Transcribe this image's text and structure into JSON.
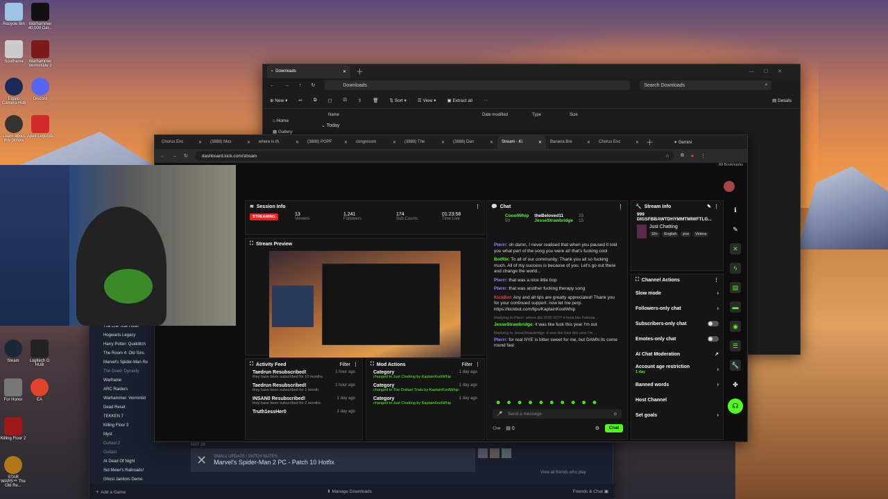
{
  "desktop": {
    "icons_left": [
      {
        "label": "Recycle Bin"
      },
      {
        "label": "Soulframe"
      },
      {
        "label": "Elgato Camera Hub"
      },
      {
        "label": "Learn about this picture"
      }
    ],
    "icons_right": [
      {
        "label": "Warhammer 40,000 Dar..."
      },
      {
        "label": "Warhammer Vermintide 2"
      },
      {
        "label": "Discord"
      },
      {
        "label": "Apex Legends"
      }
    ],
    "icons_bottom": [
      {
        "label": "Steam"
      },
      {
        "label": "Logitech G HUB"
      },
      {
        "label": "For Honor"
      },
      {
        "label": "EA"
      },
      {
        "label": "Killing Floor 2"
      },
      {
        "label": "STAR WARS™ The Old Re..."
      }
    ]
  },
  "explorer": {
    "tab_title": "Downloads",
    "path": "Downloads",
    "search_placeholder": "Search Downloads",
    "toolbar": {
      "new": "New",
      "sort": "Sort",
      "view": "View",
      "extract": "Extract all",
      "details": "Details"
    },
    "nav": {
      "home": "Home",
      "gallery": "Gallery"
    },
    "columns": {
      "name": "Name",
      "date": "Date modified",
      "type": "Type",
      "size": "Size"
    },
    "group": "Today"
  },
  "browser": {
    "tabs": [
      "Chorus Enc",
      "(3888) Mos",
      "where is th",
      "(3888) POPF",
      "congressm",
      "(3888) The",
      "(3888) Dan",
      "Stream - Ki",
      "Banana Bre",
      "Chorus Enc"
    ],
    "gemini": "Gemini",
    "url": "dashboard.kick.com/stream",
    "bookmarks": "All Bookmarks"
  },
  "session": {
    "title": "Session Info",
    "status": "STREAMING",
    "stats": [
      {
        "value": "13",
        "label": "Viewers"
      },
      {
        "value": "1,241",
        "label": "Followers"
      },
      {
        "value": "174",
        "label": "Sub Counts"
      },
      {
        "value": "01:23:58",
        "label": "Time Live"
      }
    ]
  },
  "preview": {
    "title": "Stream Preview"
  },
  "activity": {
    "title": "Activity Feed",
    "filter": "Filter",
    "items": [
      {
        "name": "Taedrun Resubscribed!",
        "sub": "they have been subscribed for 10 months",
        "time": "1 hour ago"
      },
      {
        "name": "Taedrun Resubscribed!",
        "sub": "they have been subscribed for 1 month",
        "time": "1 hour ago"
      },
      {
        "name": "INSAN0 Resubscribed!",
        "sub": "they have been subscribed for 2 months",
        "time": "1 day ago"
      },
      {
        "name": "Truth1essHer0",
        "sub": "",
        "time": "1 day ago"
      }
    ]
  },
  "mod": {
    "title": "Mod Actions",
    "filter": "Filter",
    "items": [
      {
        "title": "Category",
        "sub": "changed to Just Chatting by KaptainKoolWhip",
        "time": "1 day ago"
      },
      {
        "title": "Category",
        "sub": "changed to The Outlast Trials by KaptainKoolWhip",
        "time": "1 day ago"
      },
      {
        "title": "Category",
        "sub": "changed to Just Chatting by KaptainKoolWhip",
        "time": "1 day ago"
      }
    ]
  },
  "chat": {
    "title": "Chat",
    "leaders": [
      {
        "name": "CooolWhip",
        "count": "50"
      },
      {
        "name": "theBeloved11",
        "count": "25"
      },
      {
        "name": "JesseStrawbridge",
        "count": "15"
      }
    ],
    "messages": [
      {
        "user": "Pterrr",
        "text": "oh damn, I never realised that when you paused it told you what part of the song you were at! that's fucking cool"
      },
      {
        "user": "BotRix",
        "text": "To all of our community: Thank you all so fucking much. All of my success is because of you. Let's go out there and change the world..."
      },
      {
        "user": "Pterrr",
        "text": "that was a nice little bop"
      },
      {
        "user": "Pterrr",
        "text": "that was another fucking therapy song"
      },
      {
        "user": "KickBot",
        "text": "Any and all tips are greatly appreciated! Thank you for your continued support. now let me perp. https://kickbot.com/tips/KaptainKoolWhip"
      },
      {
        "user": "JesseStrawbridge",
        "text": "it was like fuck this year I'm out"
      },
      {
        "user": "Pterrr",
        "text": "for real NYE is bitter sweet for me, but DAMN its come round fast"
      }
    ],
    "reply1": "Replying to Pterrr: where did 2025 GO?! it feels like Februar...",
    "reply2": "Replying to JesseStrawbridge: it was like fuck this year I'm ...",
    "placeholder": "Send a message",
    "points": "0",
    "send": "Chat"
  },
  "streaminfo": {
    "title": "Stream Info",
    "viewers": "999",
    "stream_title": "DIGSFBBAWTDHYMMTMIWFTLG...",
    "category": "Just Chatting",
    "tags": [
      "18+",
      "English",
      "pve",
      "Vetera"
    ]
  },
  "channel": {
    "title": "Channel Actions",
    "rows": [
      "Slow mode",
      "Followers-only chat",
      "Subscribers-only chat",
      "Emotes-only chat",
      "AI Chat Moderation",
      "Account age restriction",
      "Banned words",
      "Host Channel",
      "Set goals"
    ],
    "age_sub": "1 day"
  },
  "steam": {
    "games": [
      "The Elle Tide Hotel",
      "Hogwarts Legacy",
      "Harry Potter: Quidditch",
      "The Room 4: Old Sins",
      "Marvel's Spider-Man Re",
      "The Deed: Dynasty",
      "Warframe",
      "ARC Raiders",
      "Warhammer: Vermintid",
      "Dead Reset",
      "TEKKEN 7",
      "Killing Floor 3",
      "Myst",
      "Outlast 2",
      "Outlast",
      "At Dead Of Night",
      "Sid Meier's Railroads!",
      "Ghost Janitors Demo"
    ],
    "news_tag": "SMALL UPDATE / PATCH NOTES",
    "news_title": "Marvel's Spider-Man 2 PC - Patch 10 Hotfix",
    "friends_view": "View all friends who play",
    "add_game": "Add a Game",
    "manage": "Manage Downloads",
    "friends_chat": "Friends & Chat",
    "date": "MAY 28"
  }
}
